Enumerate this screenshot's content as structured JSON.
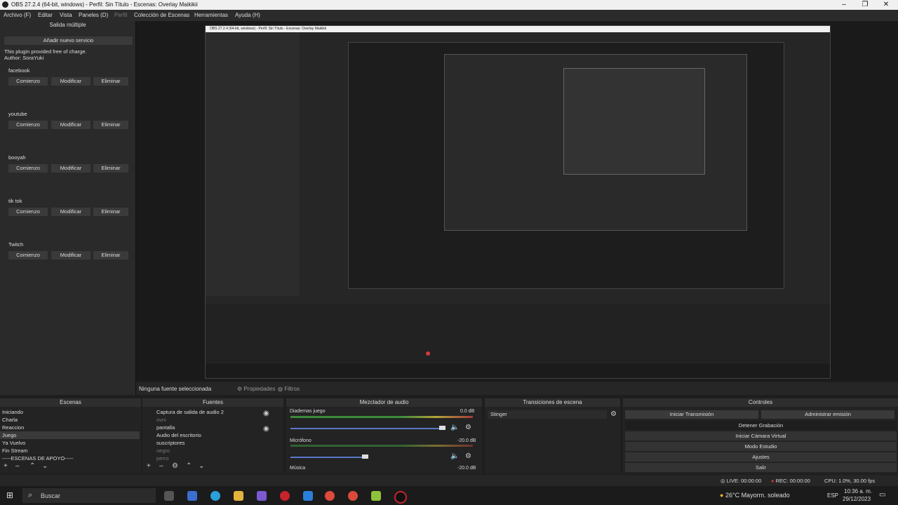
{
  "window": {
    "title": "OBS 27.2.4 (64-bit, windows) - Perfil: Sin Título - Escenas: Overlay Maikikii"
  },
  "menu": [
    "Archivo (F)",
    "Editar",
    "Vista",
    "Paneles (D)",
    "Perfil",
    "Colección de Escenas",
    "Herramientas",
    "Ayuda (H)"
  ],
  "multioutput": {
    "title": "Salida múltiple",
    "add_button": "Añadir nuevo servicio",
    "note1": "This plugin provided free of charge.",
    "note2": "Author: SoraYuki",
    "services": [
      {
        "name": "facebook"
      },
      {
        "name": "youtube"
      },
      {
        "name": "booyah"
      },
      {
        "name": "tik tok"
      },
      {
        "name": "Twitch"
      }
    ],
    "start": "Comienzo",
    "modify": "Modificar",
    "delete": "Eliminar"
  },
  "preview": {
    "no_source": "Ninguna fuente seleccionada",
    "properties": "Propiedades",
    "filters": "Filtros",
    "nested_title": "OBS 27.2.4 (64-bit, windows) - Perfil: Sin Título - Escenas: Overlay Maikikii"
  },
  "scenes": {
    "title": "Escenas",
    "items": [
      "Iniciando",
      "Charla",
      "Reaccion",
      "Juego",
      "Ya Vuelvo",
      "Fin Stream",
      "-----ESCENAS DE APOYO-----"
    ],
    "selected": 3
  },
  "sources": {
    "title": "Fuentes",
    "items": [
      "Captura de salida de audio 2",
      "ovni",
      "pantalla",
      "Audio del escritorio",
      "suscriptores",
      "negro",
      "perro"
    ]
  },
  "mixer": {
    "title": "Mezclador de audio",
    "channels": [
      {
        "name": "Diademas juego",
        "db": "0.0 dB",
        "level": 0.55,
        "volume": 0.98
      },
      {
        "name": "Micrófono",
        "db": "-20.0 dB",
        "level": 0.0,
        "volume": 0.4
      },
      {
        "name": "Música",
        "db": "-20.0 dB",
        "level": 0.0,
        "volume": 0.4
      }
    ],
    "scale": [
      "-60",
      "-55",
      "-50",
      "-45",
      "-40",
      "-35",
      "-30",
      "-25",
      "-20",
      "-15",
      "-10",
      "-5",
      "0"
    ]
  },
  "transitions": {
    "title": "Transiciones de escena",
    "value": "Stinger"
  },
  "controls": {
    "title": "Controles",
    "start_stream": "Iniciar Transmisión",
    "manage": "Administrar emisión",
    "buttons": [
      "Detener Grabación",
      "Iniciar Cámara Virtual",
      "Modo Estudio",
      "Ajustes",
      "Salir"
    ]
  },
  "status": {
    "live": "LIVE: 00:00:00",
    "rec": "REC: 00:00:00",
    "cpu": "CPU: 1.0%, 30.00 fps"
  },
  "taskbar": {
    "search": "Buscar",
    "weather": "26°C  Mayorm. soleado",
    "lang": "ESP",
    "time": "10:36 a. m.",
    "date": "29/12/2023"
  },
  "colors": {
    "rec": "#d23b3b",
    "accent": "#5a78c8",
    "obs_red": "#c8232c"
  }
}
